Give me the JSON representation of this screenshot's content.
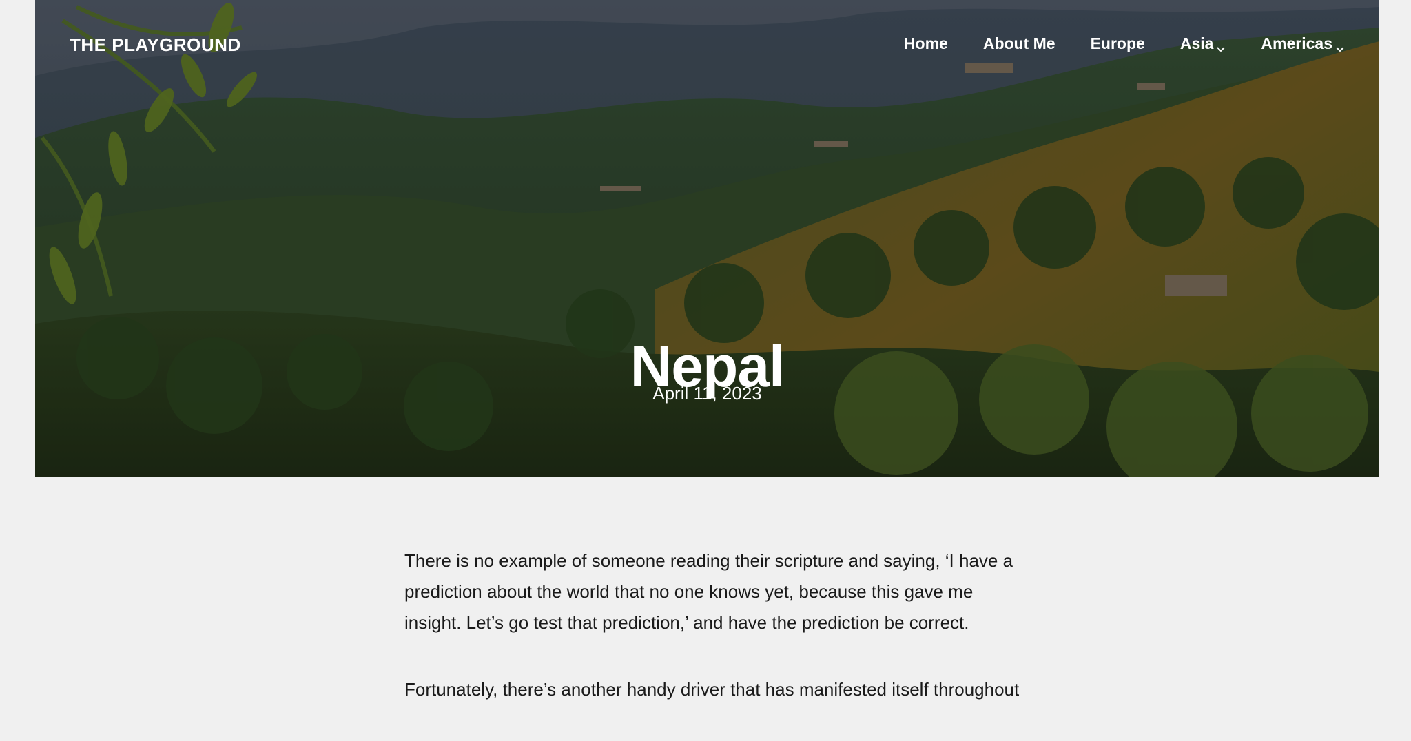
{
  "site": {
    "title": "THE PLAYGROUND"
  },
  "nav": {
    "items": [
      {
        "label": "Home",
        "has_dropdown": false
      },
      {
        "label": "About Me",
        "has_dropdown": false
      },
      {
        "label": "Europe",
        "has_dropdown": false
      },
      {
        "label": "Asia",
        "has_dropdown": true
      },
      {
        "label": "Americas",
        "has_dropdown": true
      }
    ]
  },
  "hero": {
    "title": "Nepal",
    "date": "April 11, 2023"
  },
  "article": {
    "paragraphs": [
      "There is no example of someone reading their scripture and saying, ‘I have a prediction about the world that no one knows yet, because this gave me insight. Let’s go test that prediction,’ and have the prediction be correct.",
      "Fortunately, there’s another handy driver that has manifested itself throughout"
    ]
  },
  "icons": {
    "dropdown": "chevron-down-icon"
  }
}
